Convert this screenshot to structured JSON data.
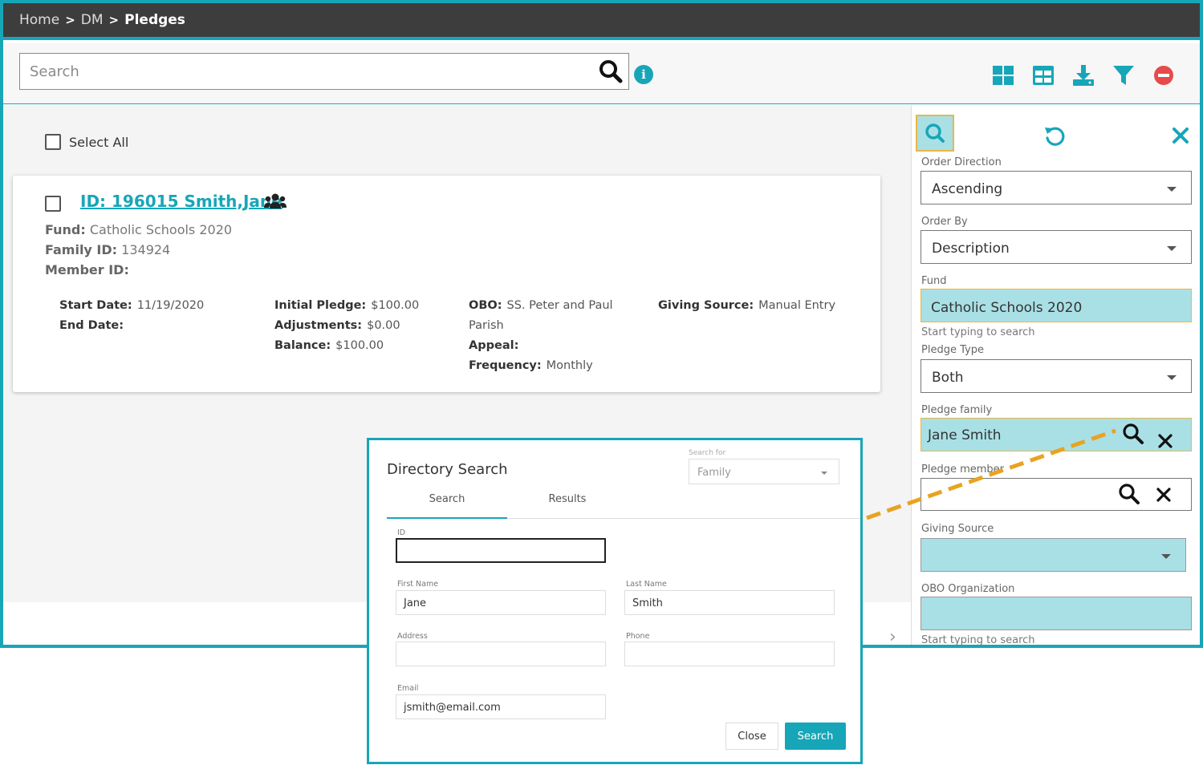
{
  "breadcrumb": [
    "Home",
    "DM",
    "Pledges"
  ],
  "search": {
    "placeholder": "Search"
  },
  "toolbar": {
    "icons": [
      "grid-view-icon",
      "table-view-icon",
      "download-icon",
      "filter-icon",
      "remove-icon"
    ],
    "accent": "#17a6b8",
    "danger": "#e84a4a"
  },
  "list": {
    "select_all": "Select All",
    "pledge": {
      "title": "ID: 196015 Smith,Jane",
      "fund_label": "Fund:",
      "fund": "Catholic Schools 2020",
      "family_id_label": "Family ID:",
      "family_id": "134924",
      "member_id_label": "Member ID:",
      "member_id": "",
      "start_date_label": "Start Date:",
      "start_date": "11/19/2020",
      "end_date_label": "End Date:",
      "end_date": "",
      "initial_pledge_label": "Initial Pledge:",
      "initial_pledge": "$100.00",
      "adjustments_label": "Adjustments:",
      "adjustments": "$0.00",
      "balance_label": "Balance:",
      "balance": "$100.00",
      "obo_label": "OBO:",
      "obo_line1": "SS. Peter and Paul",
      "obo_line2": "Parish",
      "appeal_label": "Appeal:",
      "appeal": "",
      "frequency_label": "Frequency:",
      "frequency": "Monthly",
      "giving_source_label": "Giving Source:",
      "giving_source": "Manual Entry"
    }
  },
  "filters": {
    "order_direction": {
      "label": "Order Direction",
      "value": "Ascending"
    },
    "order_by": {
      "label": "Order By",
      "value": "Description"
    },
    "fund": {
      "label": "Fund",
      "value": "Catholic Schools 2020",
      "hint": "Start typing to search"
    },
    "pledge_type": {
      "label": "Pledge Type",
      "value": "Both"
    },
    "pledge_family": {
      "label": "Pledge family",
      "value": "Jane Smith"
    },
    "pledge_member": {
      "label": "Pledge member",
      "value": ""
    },
    "giving_source": {
      "label": "Giving Source",
      "value": ""
    },
    "obo_org": {
      "label": "OBO Organization",
      "value": "",
      "hint": "Start typing to search"
    }
  },
  "directory_search": {
    "title": "Directory Search",
    "search_for_label": "Search for",
    "search_for": "Family",
    "tabs": [
      "Search",
      "Results"
    ],
    "id_label": "ID",
    "id": "",
    "first_name_label": "First Name",
    "first_name": "Jane",
    "last_name_label": "Last Name",
    "last_name": "Smith",
    "address_label": "Address",
    "address": "",
    "phone_label": "Phone",
    "phone": "",
    "email_label": "Email",
    "email": "jsmith@email.com",
    "close_label": "Close",
    "search_label": "Search"
  }
}
